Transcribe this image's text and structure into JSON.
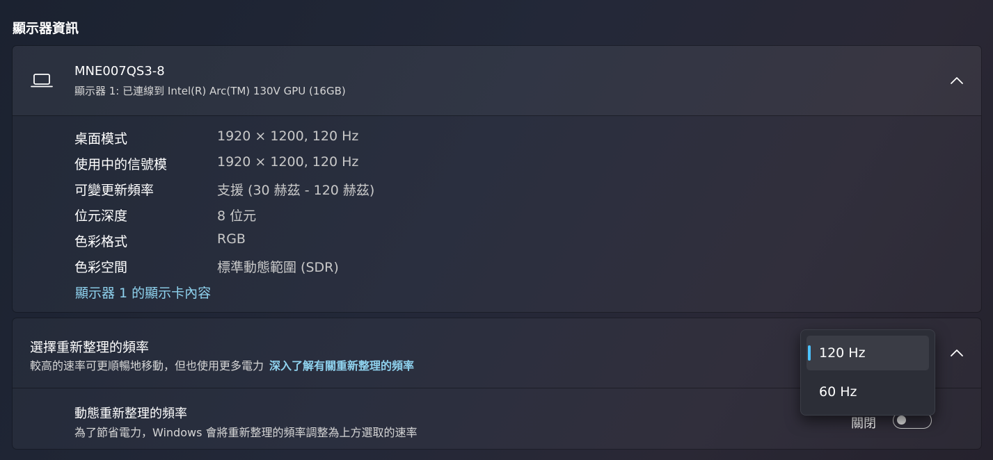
{
  "section_title": "顯示器資訊",
  "monitor": {
    "name": "MNE007QS3-8",
    "subtitle": "顯示器 1: 已連線到 Intel(R) Arc(TM) 130V GPU (16GB)",
    "icon": "laptop-icon"
  },
  "info_rows": [
    {
      "label": "桌面模式",
      "value": "1920 × 1200, 120 Hz"
    },
    {
      "label": "使用中的信號模",
      "value": "1920 × 1200, 120 Hz"
    },
    {
      "label": "可變更新頻率",
      "value": "支援 (30 赫茲 - 120 赫茲)"
    },
    {
      "label": "位元深度",
      "value": "8 位元"
    },
    {
      "label": "色彩格式",
      "value": "RGB"
    },
    {
      "label": "色彩空間",
      "value": "標準動態範圍 (SDR)"
    }
  ],
  "adapter_link": "顯示器 1 的顯示卡內容",
  "refresh_rate": {
    "title": "選擇重新整理的頻率",
    "subtitle": "較高的速率可更順暢地移動，但也使用更多電力",
    "learn_more": "深入了解有關重新整理的頻率",
    "options": [
      "120 Hz",
      "60 Hz"
    ],
    "selected": "120 Hz"
  },
  "dynamic": {
    "title": "動態重新整理的頻率",
    "subtitle": "為了節省電力，Windows 會將重新整理的頻率調整為上方選取的速率",
    "toggle_label": "關閉",
    "toggle_on": false
  },
  "colors": {
    "accent": "#4cc2ff",
    "link": "#8fd2ee"
  }
}
